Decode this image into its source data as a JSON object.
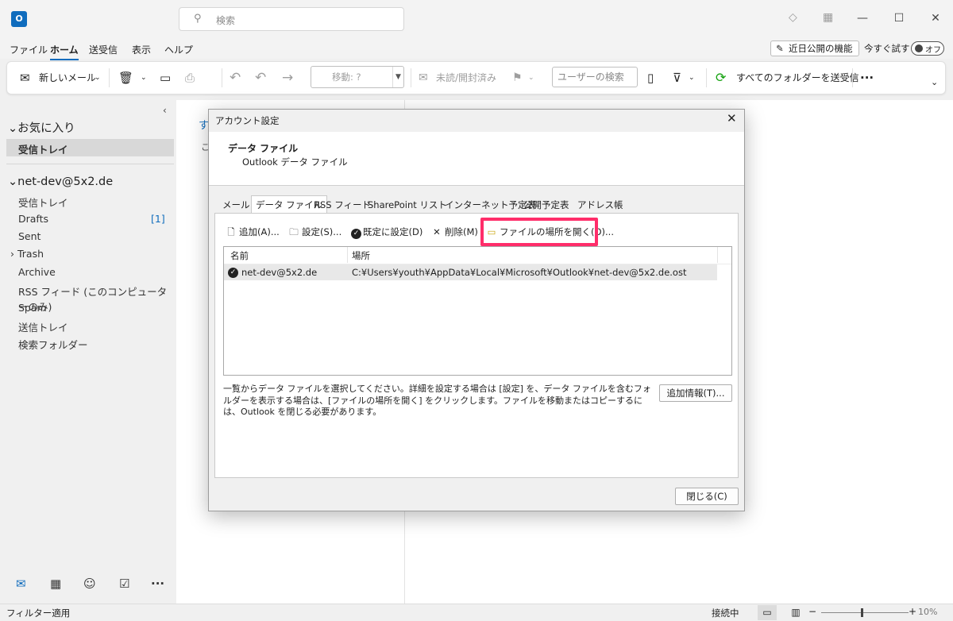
{
  "titlebar": {
    "app_icon": "O",
    "search_placeholder": "検索",
    "icons": [
      "diamond-icon",
      "qr-icon"
    ]
  },
  "menu": {
    "items": [
      "ファイル",
      "ホーム",
      "送受信",
      "表示",
      "ヘルプ"
    ],
    "active": "ホーム",
    "feature_button": "近日公開の機能",
    "try_label": "今すぐ試す",
    "toggle_label": "オフ"
  },
  "ribbon": {
    "new_mail": "新しいメール",
    "move_placeholder": "移動: ?",
    "unread_read": "未読/開封済み",
    "user_search": "ユーザーの検索",
    "send_receive_all": "すべてのフォルダーを送受信",
    "more": "···"
  },
  "leftnav": {
    "favorites_header": "お気に入り",
    "favorites": [
      "受信トレイ"
    ],
    "account": "net-dev@5x2.de",
    "folders": [
      "受信トレイ",
      "Drafts",
      "Sent",
      "Trash",
      "Archive",
      "RSS フィード (このコンピューターのみ)",
      "Spam",
      "送信トレイ",
      "検索フォルダー"
    ],
    "drafts_count": "[1]"
  },
  "main": {
    "hint_title": "す",
    "hint_sub": "こ"
  },
  "dialog": {
    "title": "アカウント設定",
    "header_title": "データ ファイル",
    "header_sub": "Outlook データ ファイル",
    "tabs": [
      "メール",
      "データ ファイル",
      "RSS フィード",
      "SharePoint リスト",
      "インターネット予定表",
      "公開予定表",
      "アドレス帳"
    ],
    "active_tab": "データ ファイル",
    "toolbar": {
      "add": "追加(A)...",
      "settings": "設定(S)...",
      "set_default": "既定に設定(D)",
      "remove": "削除(M)",
      "open_location": "ファイルの場所を開く(O)..."
    },
    "columns": [
      "名前",
      "場所"
    ],
    "rows": [
      {
        "name": "net-dev@5x2.de",
        "location": "C:¥Users¥youth¥AppData¥Local¥Microsoft¥Outlook¥net-dev@5x2.de.ost"
      }
    ],
    "description": "一覧からデータ ファイルを選択してください。詳細を設定する場合は [設定] を、データ ファイルを含むフォルダーを表示する場合は、[ファイルの場所を開く] をクリックします。ファイルを移動またはコピーするには、Outlook を閉じる必要があります。",
    "more_info": "追加情報(T)...",
    "close": "閉じる(C)"
  },
  "statusbar": {
    "left": "フィルター適用",
    "connection": "接続中",
    "zoom": "10%"
  },
  "colors": {
    "accent": "#0f6cbd",
    "highlight": "#ff2d6a"
  }
}
